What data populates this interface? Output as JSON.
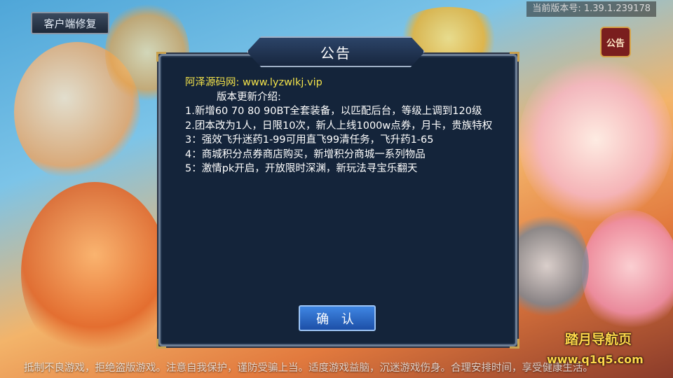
{
  "header": {
    "client_repair_label": "客户端修复",
    "version_text": "当前版本号: 1.39.1.239178",
    "notice_tab_label": "公告"
  },
  "dialog": {
    "title": "公告",
    "lines": [
      "阿泽源码网: www.lyzwlkj.vip",
      "版本更新介绍:",
      "1.新增60 70 80 90BT全套装备，以匹配后台，等级上调到120级",
      "2.团本改为1人，日限10次，新人上线1000w点券，月卡，贵族特权",
      "3：强效飞升迷药1-99可用直飞99清任务，飞升药1-65",
      "4：商城积分点券商店购买，新增积分商城一系列物品",
      "5：激情pk开启，开放限时深渊，新玩法寻宝乐翻天"
    ],
    "confirm_label": "确 认"
  },
  "footer": {
    "health_notice": "抵制不良游戏，拒绝盗版游戏。注意自我保护，谨防受骗上当。适度游戏益脑，沉迷游戏伤身。合理安排时间，享受健康生活。"
  },
  "watermark": {
    "line1": "踏月导航页",
    "line2": "www.q1q5.com"
  },
  "colors": {
    "site_line": "#f0e04a",
    "watermark": "#ffd84a",
    "confirm_button": "#2a66c8"
  }
}
